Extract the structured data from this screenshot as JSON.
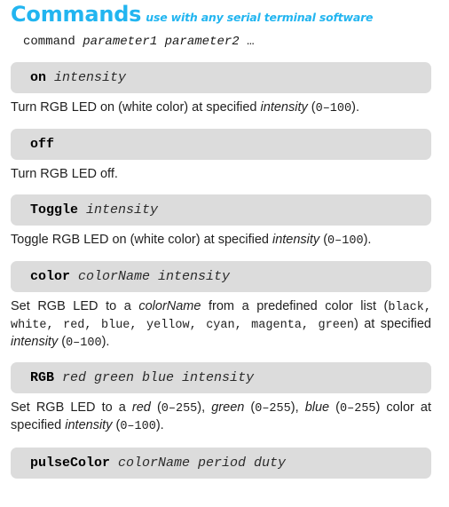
{
  "header": {
    "title": "Commands",
    "subtitle": "use with any serial terminal software",
    "accent_color": "#22b5f0"
  },
  "syntax": {
    "command": "command",
    "parameters": "parameter1 parameter2",
    "ellipsis": "…"
  },
  "styles": {
    "bar_background": "#dcdcdc",
    "text_color": "#1f1f1f"
  },
  "commands": [
    {
      "name": "on",
      "args": "intensity",
      "desc_parts": [
        {
          "text": "Turn RGB LED on (white color) at specified ",
          "style": "plain"
        },
        {
          "text": "intensity",
          "style": "italic"
        },
        {
          "text": " (",
          "style": "plain"
        },
        {
          "text": "0–100",
          "style": "mono"
        },
        {
          "text": ").",
          "style": "plain"
        }
      ]
    },
    {
      "name": "off",
      "args": "",
      "desc_parts": [
        {
          "text": "Turn RGB LED off.",
          "style": "plain"
        }
      ]
    },
    {
      "name": "Toggle",
      "args": "intensity",
      "desc_parts": [
        {
          "text": "Toggle RGB LED on (white color) at specified ",
          "style": "plain"
        },
        {
          "text": "intensity",
          "style": "italic"
        },
        {
          "text": " (",
          "style": "plain"
        },
        {
          "text": "0–100",
          "style": "mono"
        },
        {
          "text": ").",
          "style": "plain"
        }
      ]
    },
    {
      "name": "color",
      "args": "colorName intensity",
      "desc_parts": [
        {
          "text": "Set RGB LED to a ",
          "style": "plain"
        },
        {
          "text": "colorName",
          "style": "italic"
        },
        {
          "text": " from a predefined color list (",
          "style": "plain"
        },
        {
          "text": "black, white, red, blue, yellow, cyan, magenta, green",
          "style": "mono"
        },
        {
          "text": ") at specified ",
          "style": "plain"
        },
        {
          "text": "intensity",
          "style": "italic"
        },
        {
          "text": " (",
          "style": "plain"
        },
        {
          "text": "0–100",
          "style": "mono"
        },
        {
          "text": ").",
          "style": "plain"
        }
      ]
    },
    {
      "name": "RGB",
      "args": "red green blue intensity",
      "desc_parts": [
        {
          "text": "Set RGB LED to a ",
          "style": "plain"
        },
        {
          "text": "red",
          "style": "italic"
        },
        {
          "text": " (",
          "style": "plain"
        },
        {
          "text": "0–255",
          "style": "mono"
        },
        {
          "text": "), ",
          "style": "plain"
        },
        {
          "text": "green",
          "style": "italic"
        },
        {
          "text": " (",
          "style": "plain"
        },
        {
          "text": "0–255",
          "style": "mono"
        },
        {
          "text": "), ",
          "style": "plain"
        },
        {
          "text": "blue",
          "style": "italic"
        },
        {
          "text": " (",
          "style": "plain"
        },
        {
          "text": "0–255",
          "style": "mono"
        },
        {
          "text": ") color at specified ",
          "style": "plain"
        },
        {
          "text": "intensity",
          "style": "italic"
        },
        {
          "text": " (",
          "style": "plain"
        },
        {
          "text": "0–100",
          "style": "mono"
        },
        {
          "text": ").",
          "style": "plain"
        }
      ]
    },
    {
      "name": "pulseColor",
      "args": "colorName period duty",
      "desc_parts": []
    }
  ]
}
